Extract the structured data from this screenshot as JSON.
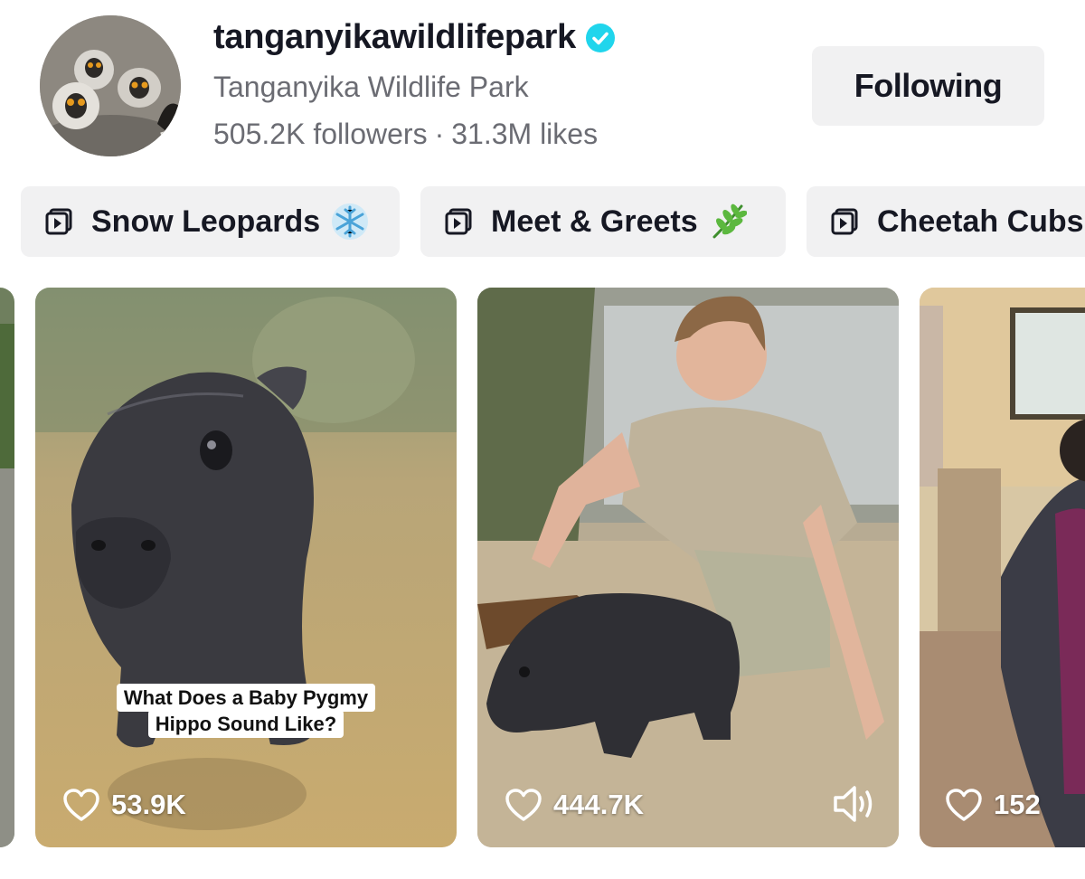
{
  "profile": {
    "username": "tanganyikawildlifepark",
    "display_name": "Tanganyika Wildlife Park",
    "followers": "505.2K followers",
    "separator": "·",
    "likes": "31.3M likes",
    "verified": true,
    "avatar_icon": "lemur-avatar"
  },
  "follow_button": {
    "label": "Following"
  },
  "playlists": [
    {
      "label": "Snow Leopards",
      "emoji": "snowflake-emoji",
      "icon": "playlist-icon"
    },
    {
      "label": "Meet & Greets",
      "emoji": "herb-emoji",
      "icon": "playlist-icon"
    },
    {
      "label": "Cheetah Cubs",
      "icon": "playlist-icon"
    }
  ],
  "videos": [
    {
      "caption_line1": "What Does a Baby Pygmy",
      "caption_line2": "Hippo Sound Like?",
      "likes": "53.9K"
    },
    {
      "likes": "444.7K",
      "sound_icon": "volume-icon"
    },
    {
      "likes": "152"
    }
  ],
  "colors": {
    "verified": "#20d5ec",
    "chip_bg": "#f1f1f2",
    "secondary_text": "#6b6c73"
  }
}
